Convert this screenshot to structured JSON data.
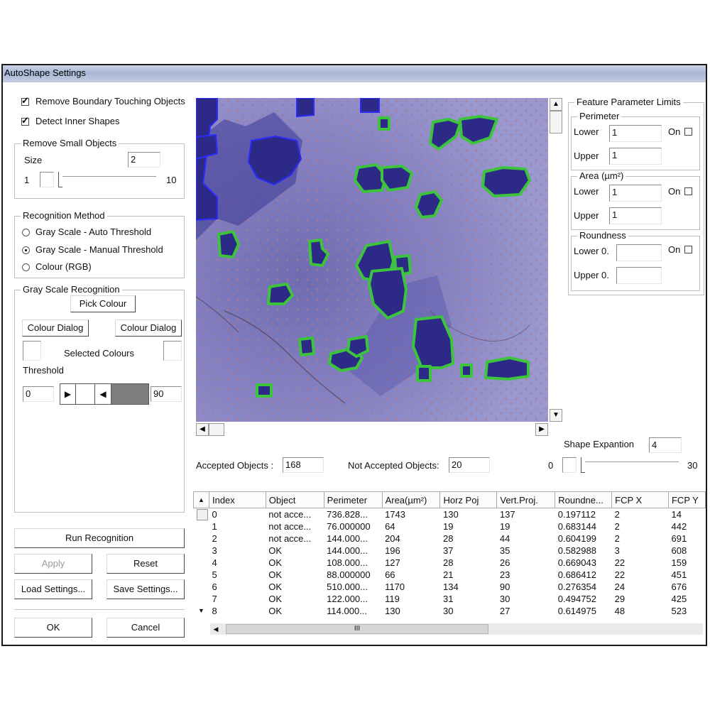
{
  "window": {
    "title": "AutoShape Settings"
  },
  "options": {
    "remove_boundary": {
      "label": "Remove Boundary Touching Objects",
      "checked": true
    },
    "detect_inner": {
      "label": "Detect Inner Shapes",
      "checked": true
    }
  },
  "small_objects": {
    "group_label": "Remove Small Objects",
    "size_label": "Size",
    "size_value": "2",
    "min_label": "1",
    "max_label": "10"
  },
  "recognition_method": {
    "group_label": "Recognition Method",
    "options": [
      {
        "label": "Gray Scale - Auto Threshold",
        "selected": false
      },
      {
        "label": "Gray Scale - Manual Threshold",
        "selected": true
      },
      {
        "label": "Colour (RGB)",
        "selected": false
      }
    ]
  },
  "gray_scale": {
    "group_label": "Gray Scale Recognition",
    "pick_colour": "Pick Colour",
    "colour_dialog_left": "Colour Dialog",
    "colour_dialog_right": "Colour Dialog",
    "selected_colours": "Selected Colours",
    "threshold_label": "Threshold",
    "threshold_min": "0",
    "threshold_max": "90"
  },
  "buttons": {
    "run_recognition": "Run Recognition",
    "apply": "Apply",
    "reset": "Reset",
    "load_settings": "Load Settings...",
    "save_settings": "Save Settings...",
    "ok": "OK",
    "cancel": "Cancel"
  },
  "feature_limits": {
    "group_label": "Feature Parameter Limits",
    "perimeter": {
      "label": "Perimeter",
      "lower_label": "Lower",
      "lower_value": "1",
      "upper_label": "Upper",
      "upper_value": "1",
      "on_label": "On"
    },
    "area": {
      "label": "Area (µm²)",
      "lower_label": "Lower",
      "lower_value": "1",
      "upper_label": "Upper",
      "upper_value": "1",
      "on_label": "On"
    },
    "roundness": {
      "label": "Roundness",
      "lower_label": "Lower 0.",
      "lower_value": "",
      "upper_label": "Upper 0.",
      "upper_value": "",
      "on_label": "On"
    }
  },
  "shape_expansion": {
    "label": "Shape Expantion",
    "value": "4",
    "min_label": "0",
    "max_label": "30"
  },
  "counts": {
    "accepted_label": "Accepted Objects :",
    "accepted_value": "168",
    "not_accepted_label": "Not Accepted Objects:",
    "not_accepted_value": "20"
  },
  "table": {
    "columns": [
      "Index",
      "Object",
      "Perimeter",
      "Area(µm²)",
      "Horz Poj",
      "Vert.Proj.",
      "Roundne...",
      "FCP X",
      "FCP Y"
    ],
    "rows": [
      [
        "0",
        "not acce...",
        "736.828...",
        "1743",
        "130",
        "137",
        "0.197112",
        "2",
        "14"
      ],
      [
        "1",
        "not acce...",
        "76.000000",
        "64",
        "19",
        "19",
        "0.683144",
        "2",
        "442"
      ],
      [
        "2",
        "not acce...",
        "144.000...",
        "204",
        "28",
        "44",
        "0.604199",
        "2",
        "691"
      ],
      [
        "3",
        "OK",
        "144.000...",
        "196",
        "37",
        "35",
        "0.582988",
        "3",
        "608"
      ],
      [
        "4",
        "OK",
        "108.000...",
        "127",
        "28",
        "26",
        "0.669043",
        "22",
        "159"
      ],
      [
        "5",
        "OK",
        "88.000000",
        "66",
        "21",
        "23",
        "0.686412",
        "22",
        "451"
      ],
      [
        "6",
        "OK",
        "510.000...",
        "1170",
        "134",
        "90",
        "0.276354",
        "24",
        "676"
      ],
      [
        "7",
        "OK",
        "122.000...",
        "119",
        "31",
        "30",
        "0.494752",
        "29",
        "425"
      ],
      [
        "8",
        "OK",
        "114.000...",
        "130",
        "30",
        "27",
        "0.614975",
        "48",
        "523"
      ]
    ],
    "hscroll_grip": "III"
  },
  "colors": {
    "image_bg": "#8a88c2",
    "accepted_outline": "#3dc43d",
    "rejected_outline": "#2a2aff",
    "object_fill": "#2c2a86"
  }
}
